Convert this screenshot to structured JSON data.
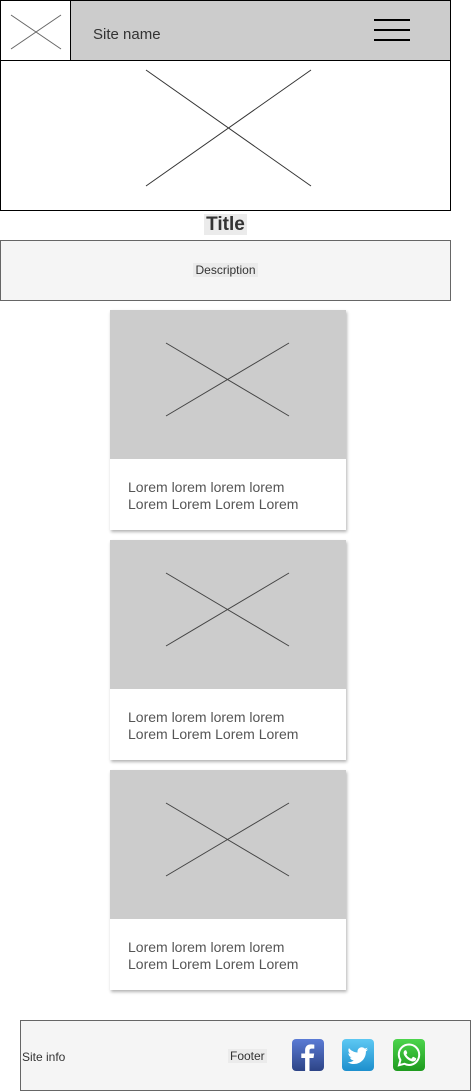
{
  "header": {
    "site_name": "Site name",
    "logo_icon": "image-placeholder-icon",
    "menu_icon": "hamburger-menu-icon"
  },
  "hero": {
    "icon": "image-placeholder-icon"
  },
  "main": {
    "title": "Title",
    "description": "Description",
    "cards": [
      {
        "line1": "Lorem lorem lorem lorem",
        "line2": "Lorem Lorem Lorem Lorem",
        "icon": "image-placeholder-icon"
      },
      {
        "line1": "Lorem lorem lorem lorem",
        "line2": "Lorem Lorem Lorem Lorem",
        "icon": "image-placeholder-icon"
      },
      {
        "line1": "Lorem lorem lorem lorem",
        "line2": "Lorem Lorem Lorem Lorem",
        "icon": "image-placeholder-icon"
      }
    ]
  },
  "footer": {
    "site_info": "Site info",
    "label": "Footer",
    "social": [
      {
        "icon": "facebook-icon",
        "color": "#3b5998"
      },
      {
        "icon": "twitter-icon",
        "color": "#2ca7e0"
      },
      {
        "icon": "whatsapp-icon",
        "color": "#2fb12f"
      }
    ]
  },
  "colors": {
    "header_bg": "#cccccc",
    "panel_bg": "#f5f5f5",
    "placeholder_bg": "#cccccc"
  }
}
